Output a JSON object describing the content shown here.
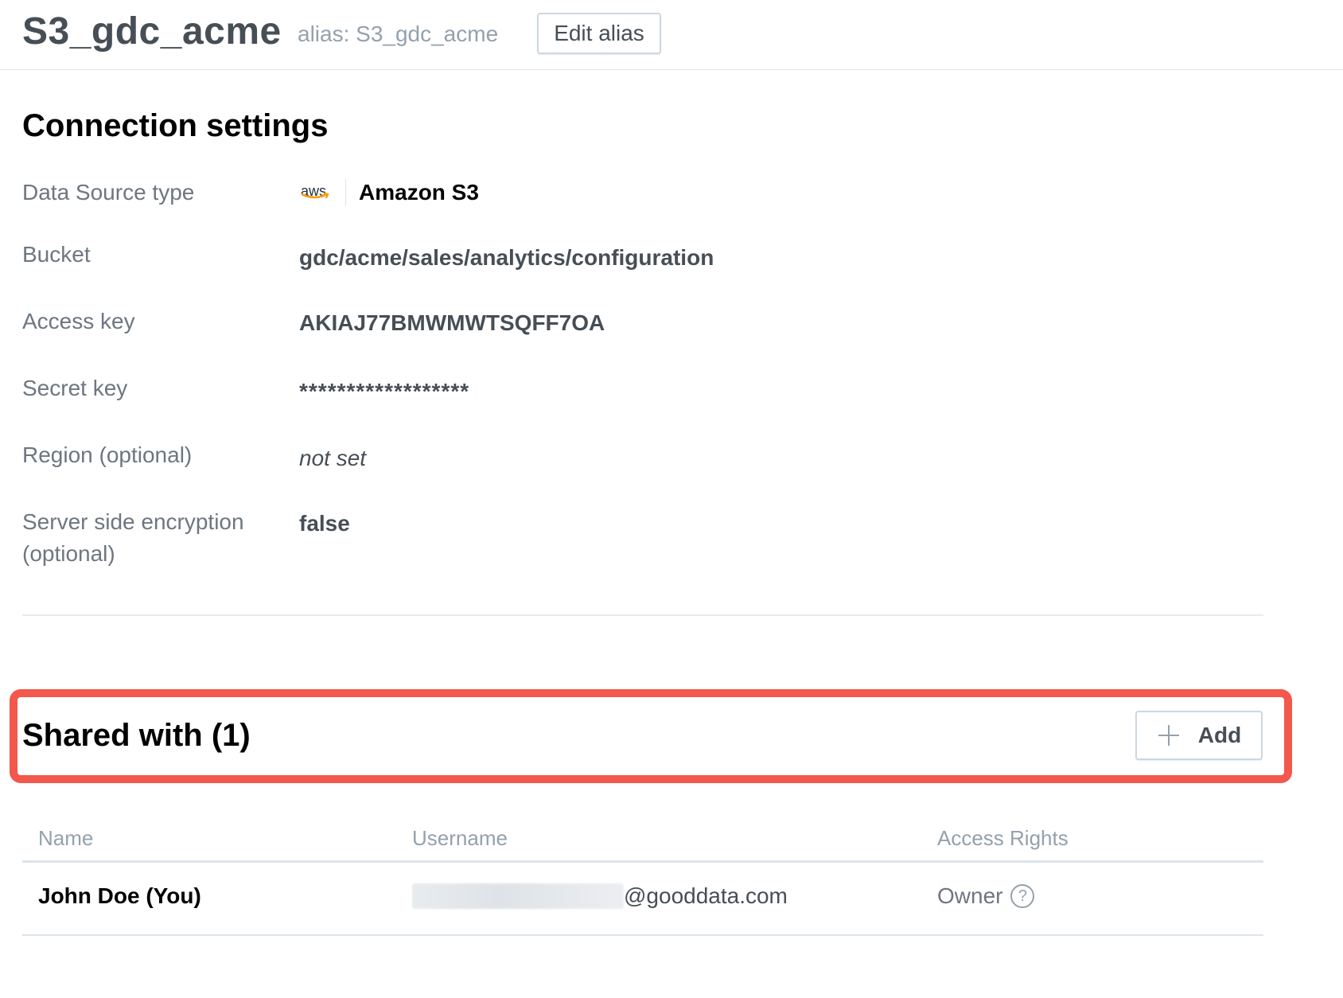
{
  "header": {
    "title": "S3_gdc_acme",
    "alias": "alias: S3_gdc_acme",
    "edit_alias_label": "Edit alias"
  },
  "connection": {
    "title": "Connection settings",
    "rows": [
      {
        "label": "Data Source type",
        "value": "Amazon S3",
        "icon": "aws-logo"
      },
      {
        "label": "Bucket",
        "value": "gdc/acme/sales/analytics/configuration"
      },
      {
        "label": "Access key",
        "value": "AKIAJ77BMWMWTSQFF7OA"
      },
      {
        "label": "Secret key",
        "value": "******************"
      },
      {
        "label": "Region (optional)",
        "value": "not set"
      },
      {
        "label": "Server side encryption (optional)",
        "value": "false"
      }
    ],
    "aws_logo_text": "aws"
  },
  "shared": {
    "title": "Shared with (1)",
    "add_label": "Add",
    "highlight_color": "#f4574c"
  },
  "table": {
    "columns": [
      "Name",
      "Username",
      "Access Rights"
    ],
    "rows": [
      {
        "name": "John Doe (You)",
        "username_domain": "@gooddata.com",
        "access": "Owner",
        "help_icon": "?"
      }
    ]
  }
}
